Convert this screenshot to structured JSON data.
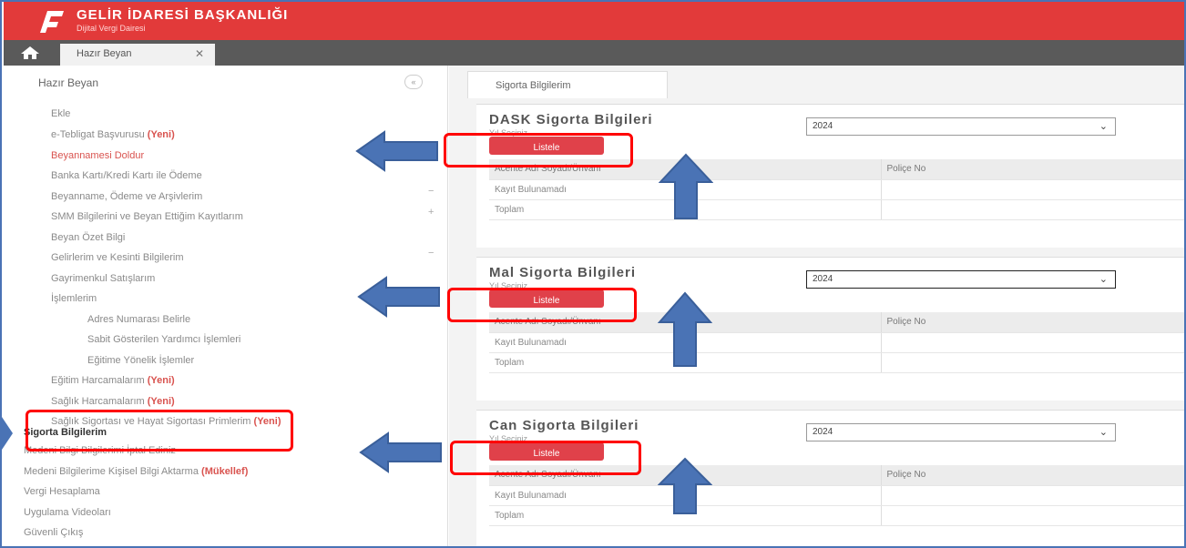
{
  "header": {
    "title": "GELİR İDARESİ BAŞKANLIĞI",
    "subtitle": "Dijital Vergi Dairesi"
  },
  "tabs": {
    "home_label": "Hazır Beyan",
    "close_label": "✕"
  },
  "sidebar": {
    "title": "Hazır Beyan",
    "collapse_label": "«",
    "items": [
      {
        "label": "Ekle"
      },
      {
        "label": "e-Tebligat Başvurusu",
        "tag": "(Yeni)"
      },
      {
        "label": "Beyannamesi Doldur"
      },
      {
        "label": "Banka Kartı/Kredi Kartı ile Ödeme"
      },
      {
        "label": "Beyanname, Ödeme ve Arşivlerim"
      },
      {
        "label": "SMM Bilgilerini ve Beyan Ettiğim Kayıtlarım"
      },
      {
        "label": "Beyan Özet Bilgi"
      },
      {
        "label": "Gelirlerim ve Kesinti Bilgilerim"
      },
      {
        "label": "Gayrimenkul Satışlarım"
      },
      {
        "label": "İşlemlerim"
      },
      {
        "label": "Adres Numarası Belirle"
      },
      {
        "label": "Sabit Gösterilen Yardımcı İşlemleri"
      },
      {
        "label": "Eğitime Yönelik İşlemler"
      },
      {
        "label": "Eğitim Harcamalarım",
        "tag": "(Yeni)"
      },
      {
        "label": "Sağlık Harcamalarım",
        "tag": "(Yeni)"
      },
      {
        "label": "Sağlık Sigortası ve Hayat Sigortası Primlerim",
        "tag": "(Yeni)"
      },
      {
        "label": "Sigorta Bilgilerim"
      },
      {
        "label": "Medeni Bilgi Bilgilerimi İptal Ediniz"
      },
      {
        "label": "Medeni Bilgilerime Kişisel Bilgi Aktarma",
        "tag": "(Mükellef)"
      },
      {
        "label": "Vergi Hesaplama"
      },
      {
        "label": "Uygulama Videoları"
      },
      {
        "label": "Güvenli Çıkış"
      }
    ]
  },
  "content": {
    "tab_label": "Sigorta Bilgilerim",
    "panels": [
      {
        "title": "DASK Sigorta Bilgileri",
        "year_label": "Yıl Seçiniz",
        "year_value": "2024",
        "button": "Listele",
        "rows": [
          [
            "Acente Adı Soyadı/Ünvanı",
            "Poliçe No"
          ],
          [
            "Kayıt Bulunamadı",
            ""
          ],
          [
            "Toplam",
            ""
          ]
        ]
      },
      {
        "title": "Mal Sigorta Bilgileri",
        "year_label": "Yıl Seçiniz",
        "year_value": "2024",
        "button": "Listele",
        "rows": [
          [
            "Acente Adı Soyadı/Ünvanı",
            "Poliçe No"
          ],
          [
            "Kayıt Bulunamadı",
            ""
          ],
          [
            "Toplam",
            ""
          ]
        ]
      },
      {
        "title": "Can Sigorta Bilgileri",
        "year_label": "Yıl Seçiniz",
        "year_value": "2024",
        "button": "Listele",
        "rows": [
          [
            "Acente Adı Soyadı/Ünvanı",
            "Poliçe No"
          ],
          [
            "Kayıt Bulunamadı",
            ""
          ],
          [
            "Toplam",
            ""
          ]
        ]
      }
    ]
  },
  "icons": {
    "logo": "gib-logo-icon",
    "home": "home-icon",
    "chevron": "chevron-down-icon",
    "arrow_left": "arrow-left-icon",
    "arrow_up": "arrow-up-icon"
  },
  "colors": {
    "brand_red": "#e23a3a",
    "button_red": "#e0414a",
    "highlight_red": "#ff0000",
    "arrow_blue": "#4a73b5",
    "tabbar_gray": "#5a5a5a"
  }
}
